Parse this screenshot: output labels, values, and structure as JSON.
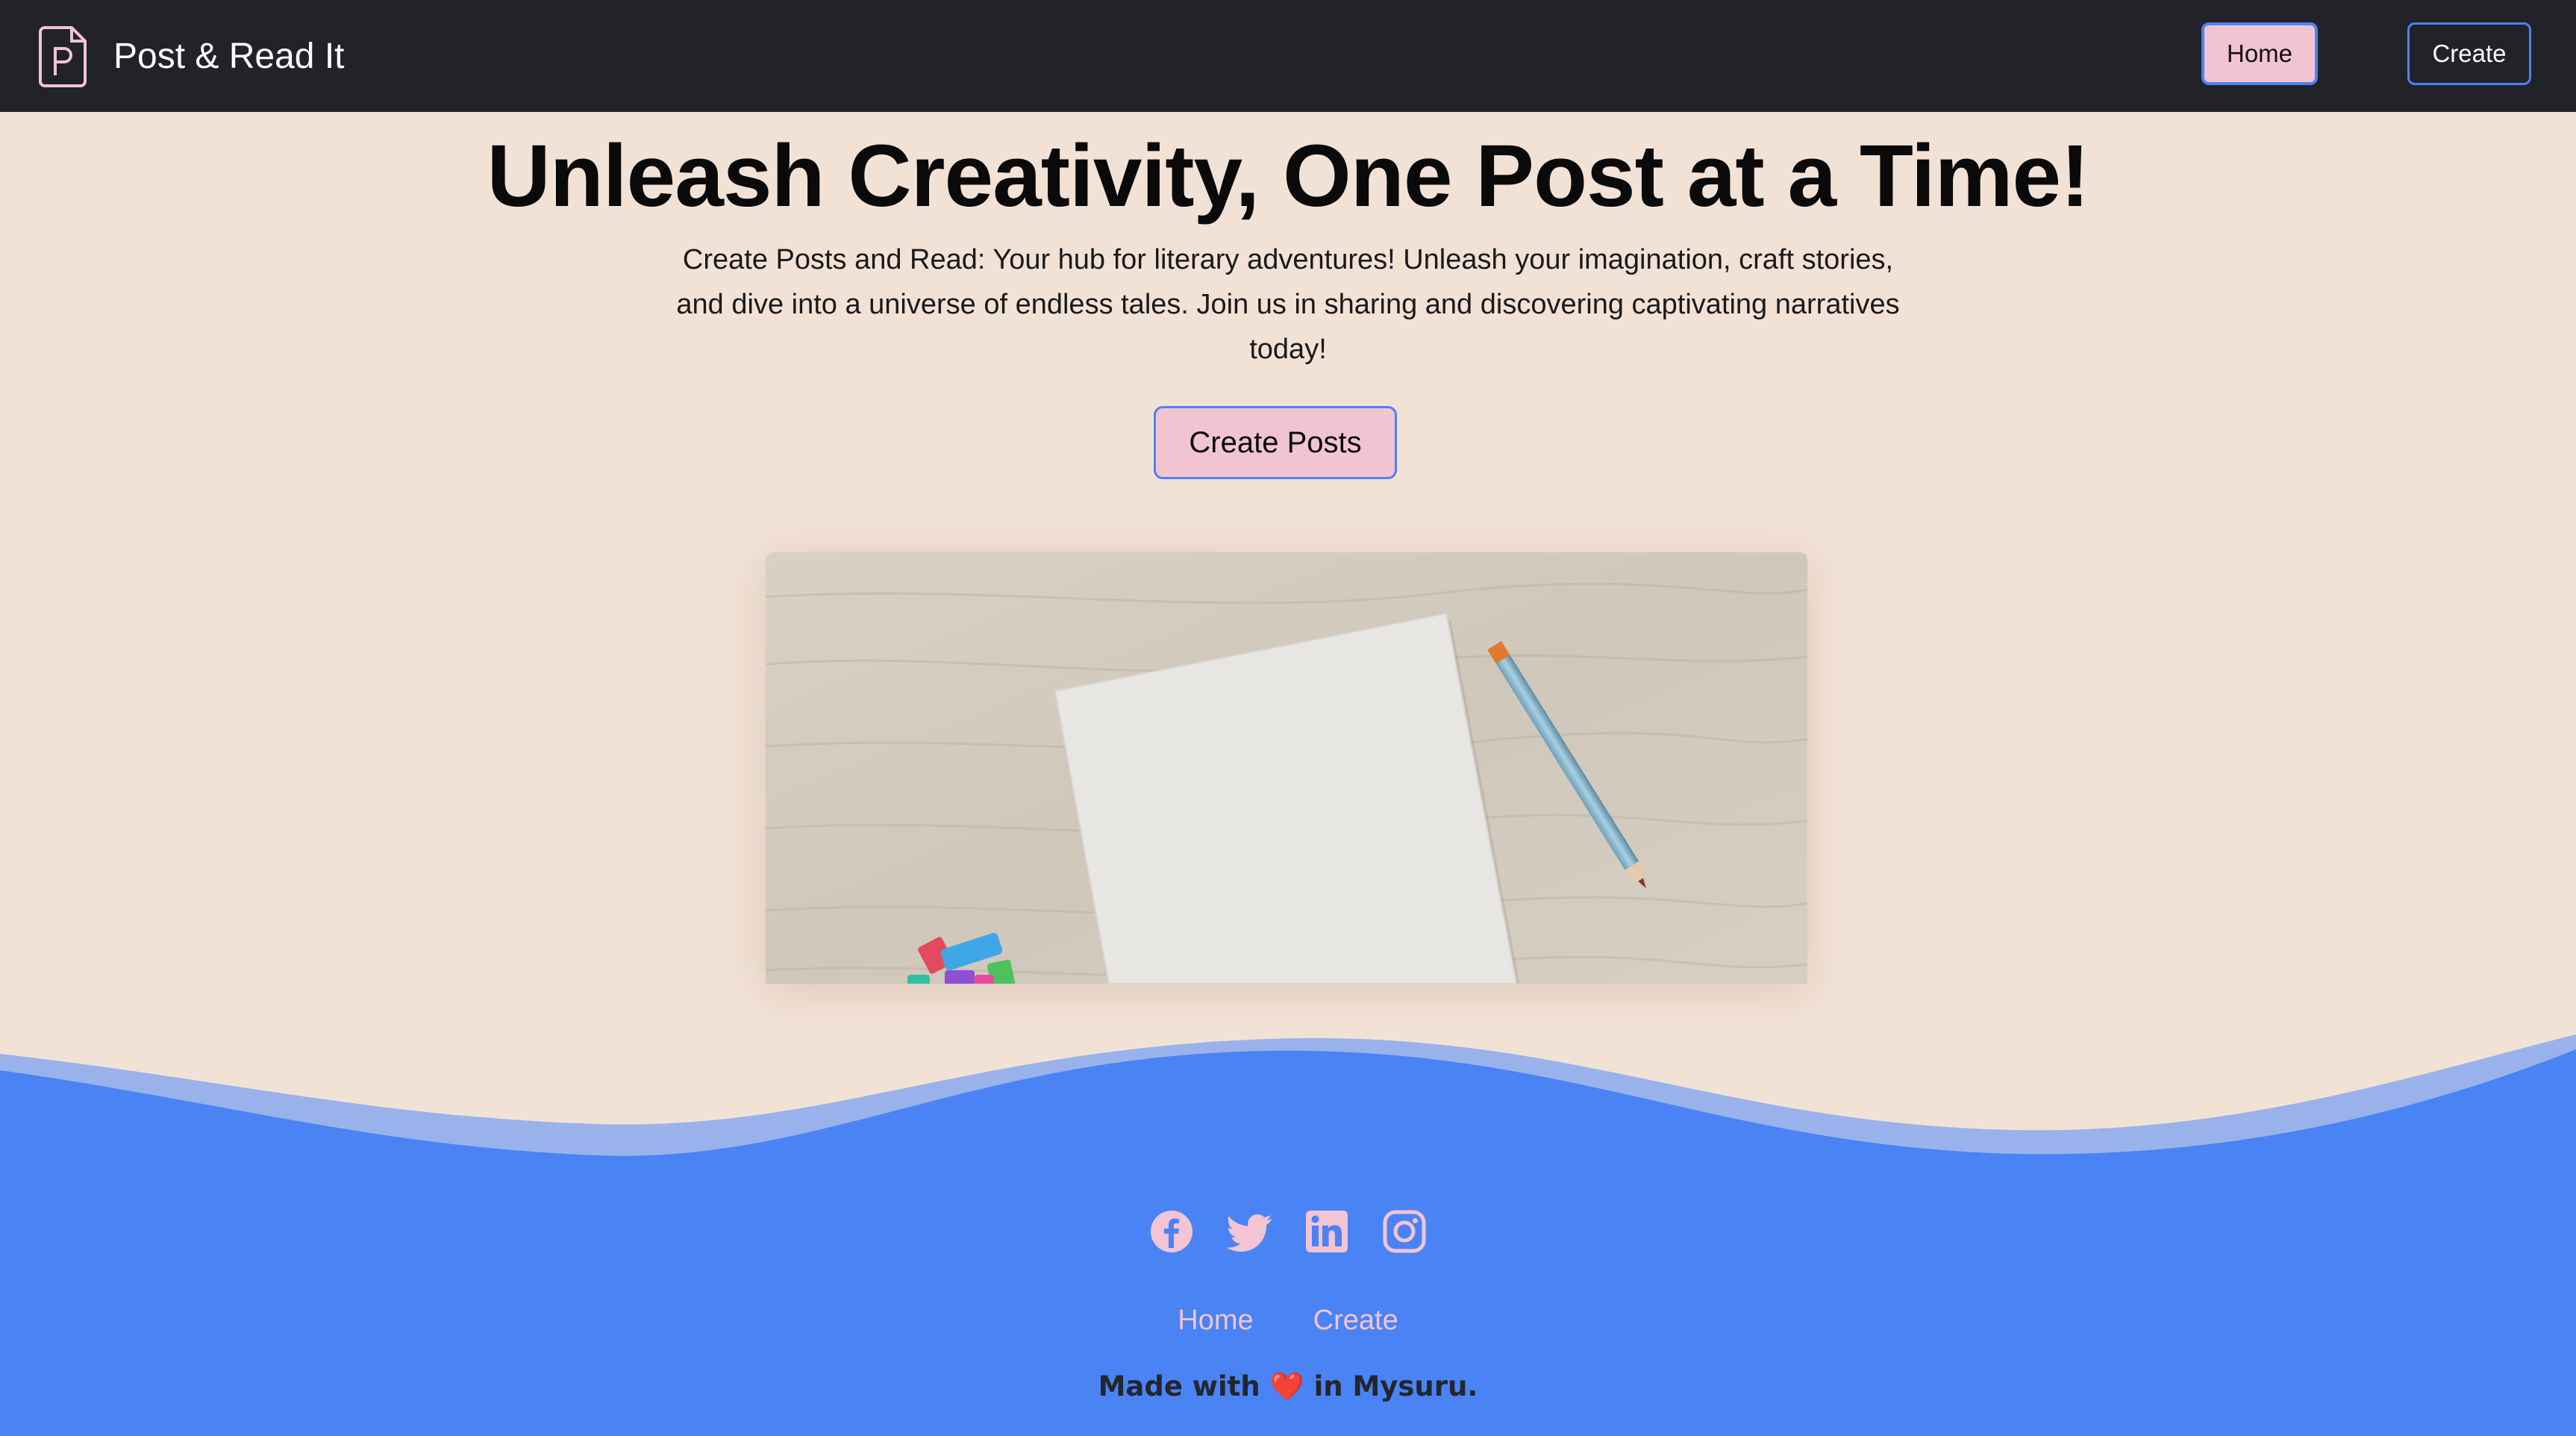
{
  "navbar": {
    "brand_text": "Post & Read It",
    "brand_icon": "document-p-icon",
    "home_label": "Home",
    "create_label": "Create"
  },
  "hero": {
    "title": "Unleash Creativity, One Post at a Time!",
    "description": "Create Posts and Read: Your hub for literary adventures! Unleash your imagination, craft stories, and dive into a universe of endless tales. Join us in sharing and discovering captivating narratives today!",
    "cta_label": "Create Posts"
  },
  "footer": {
    "social_icons": [
      "facebook-icon",
      "twitter-icon",
      "linkedin-icon",
      "instagram-icon"
    ],
    "links": [
      "Home",
      "Create"
    ],
    "made_with_prefix": "Made with",
    "heart": "❤️",
    "made_with_suffix": "in Mysuru."
  },
  "colors": {
    "navbar_bg": "#212328",
    "page_bg": "#f2e2d6",
    "accent_pink": "#f1c4d2",
    "accent_blue": "#4c82f4",
    "footer_bg": "#4a83f4"
  }
}
